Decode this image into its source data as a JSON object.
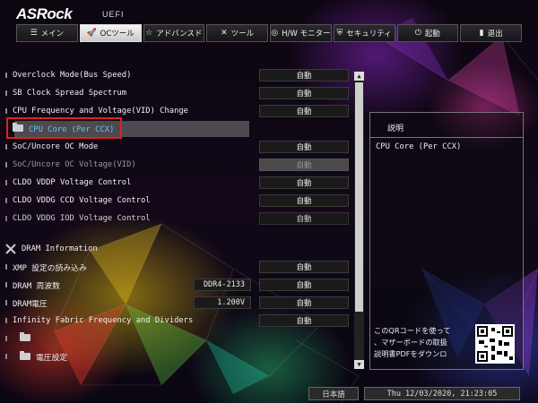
{
  "header": {
    "brand": "ASRock",
    "brand_sub": "UEFI"
  },
  "tabs": [
    {
      "label": "メイン",
      "icon": "list-icon"
    },
    {
      "label": "OCツール",
      "icon": "rocket-icon",
      "active": true
    },
    {
      "label": "アドバンスド",
      "icon": "star-icon"
    },
    {
      "label": "ツール",
      "icon": "wrench-icon"
    },
    {
      "label": "H/W モニター",
      "icon": "monitor-icon"
    },
    {
      "label": "セキュリティ",
      "icon": "shield-icon"
    },
    {
      "label": "起動",
      "icon": "power-icon"
    },
    {
      "label": "退出",
      "icon": "exit-icon"
    }
  ],
  "menu": {
    "overclock_mode": {
      "label": "Overclock Mode(Bus Speed)",
      "value": "自動"
    },
    "sb_clock": {
      "label": "SB Clock Spread Spectrum",
      "value": "自動"
    },
    "cpu_freq": {
      "label": "CPU Frequency and Voltage(VID) Change",
      "value": "自動"
    },
    "cpu_core": {
      "label": "CPU Core (Per CCX)"
    },
    "soc_uncore_mode": {
      "label": "SoC/Uncore OC Mode",
      "value": "自動"
    },
    "soc_uncore_volt": {
      "label": "SoC/Uncore OC Voltage(VID)",
      "value": "自動"
    },
    "cldo_vddp": {
      "label": "CLDO VDDP Voltage Control",
      "value": "自動"
    },
    "cldo_vddg_ccd": {
      "label": "CLDO VDDG CCD Voltage Control",
      "value": "自動"
    },
    "cldo_vddg_iod": {
      "label": "CLDO VDDG IOD Voltage Control",
      "value": "自動"
    },
    "dram_info": {
      "label": "DRAM Information"
    },
    "xmp": {
      "label": "XMP 設定の読み込み",
      "value": "自動"
    },
    "dram_freq": {
      "label": "DRAM 周波数",
      "field": "DDR4-2133",
      "value": "自動"
    },
    "dram_volt": {
      "label": "DRAM電圧",
      "field": "1.200V",
      "value": "自動"
    },
    "infinity_fabric": {
      "label": "Infinity Fabric Frequency and Dividers",
      "value": "自動"
    },
    "voltage_settings": {
      "label": "電圧設定"
    }
  },
  "description": {
    "title": "説明",
    "body": "CPU Core (Per CCX)",
    "qr_line1": "このQRコードを使って",
    "qr_line2": "、マザーボードの取扱",
    "qr_line3": "説明書PDFをダウンロ"
  },
  "footer": {
    "language": "日本語",
    "datetime": "Thu 12/03/2020, 21:23:05"
  }
}
